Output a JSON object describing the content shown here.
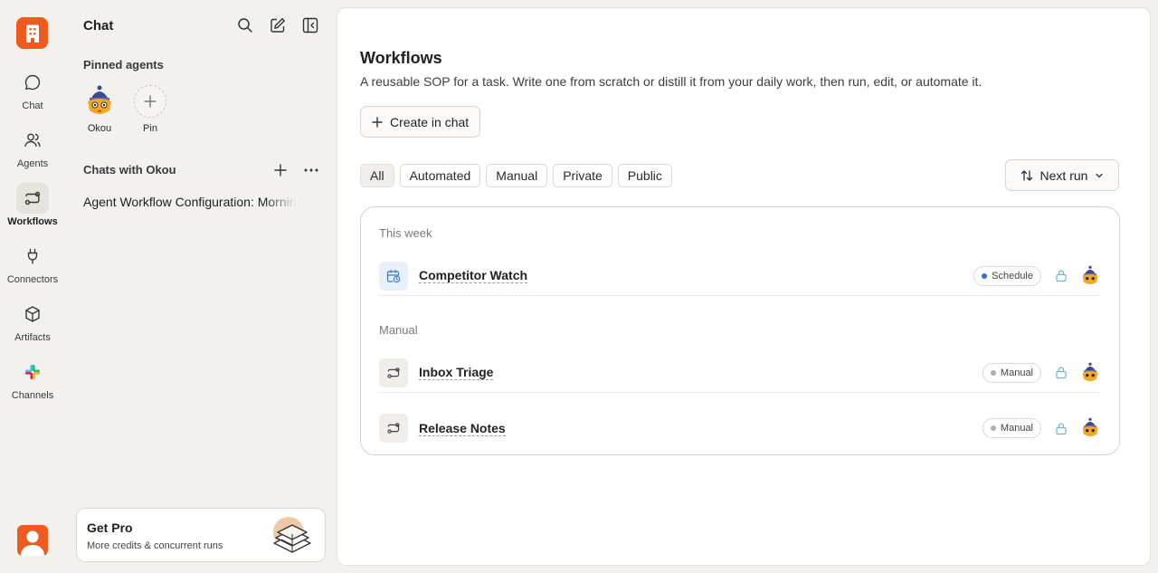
{
  "rail": {
    "items": [
      {
        "label": "Chat",
        "icon": "chat-bubble-icon"
      },
      {
        "label": "Agents",
        "icon": "users-icon"
      },
      {
        "label": "Workflows",
        "icon": "workflow-icon"
      },
      {
        "label": "Connectors",
        "icon": "plug-icon"
      },
      {
        "label": "Artifacts",
        "icon": "cube-icon"
      },
      {
        "label": "Channels",
        "icon": "slack-icon"
      }
    ],
    "active": "Workflows"
  },
  "panel": {
    "title": "Chat",
    "pinned_heading": "Pinned agents",
    "agents": [
      {
        "label": "Okou"
      },
      {
        "label": "Pin"
      }
    ],
    "chats_heading": "Chats with Okou",
    "chats": [
      {
        "title": "Agent Workflow Configuration: Morning Briefing"
      }
    ],
    "pro": {
      "title": "Get Pro",
      "subtitle": "More credits & concurrent runs"
    }
  },
  "main": {
    "title": "Workflows",
    "subtitle": "A reusable SOP for a task. Write one from scratch or distill it from your daily work, then run, edit, or automate it.",
    "create_label": "Create in chat",
    "filters": [
      "All",
      "Automated",
      "Manual",
      "Private",
      "Public"
    ],
    "active_filter": "All",
    "sort_label": "Next run",
    "groups": [
      {
        "heading": "This week",
        "rows": [
          {
            "name": "Competitor Watch",
            "badge": "Schedule",
            "badge_color": "#2f6fd6",
            "icon": "calendar-clock-icon"
          }
        ]
      },
      {
        "heading": "Manual",
        "rows": [
          {
            "name": "Inbox Triage",
            "badge": "Manual",
            "badge_color": "#b0aca6",
            "icon": "workflow-icon"
          },
          {
            "name": "Release Notes",
            "badge": "Manual",
            "badge_color": "#b0aca6",
            "icon": "workflow-icon"
          }
        ]
      }
    ]
  },
  "colors": {
    "brand": "#ef5a1e",
    "lock": "#6fb6c9",
    "background": "#f3f1ee"
  }
}
